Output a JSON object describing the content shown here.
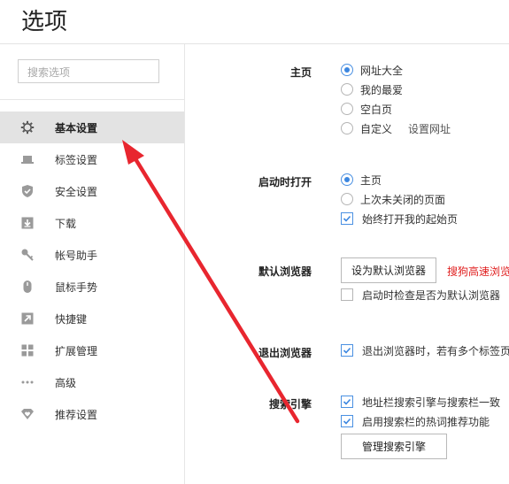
{
  "window": {
    "title": "选项"
  },
  "search": {
    "placeholder": "搜索选项"
  },
  "sidebar": {
    "items": [
      {
        "label": "基本设置",
        "icon": "gear-icon",
        "active": true
      },
      {
        "label": "标签设置",
        "icon": "tab-icon"
      },
      {
        "label": "安全设置",
        "icon": "shield-check-icon"
      },
      {
        "label": "下载",
        "icon": "download-icon"
      },
      {
        "label": "帐号助手",
        "icon": "key-icon"
      },
      {
        "label": "鼠标手势",
        "icon": "mouse-icon"
      },
      {
        "label": "快捷键",
        "icon": "shortcut-arrow-icon"
      },
      {
        "label": "扩展管理",
        "icon": "extensions-grid-icon"
      },
      {
        "label": "高级",
        "icon": "more-dots-icon"
      },
      {
        "label": "推荐设置",
        "icon": "heart-badge-icon"
      }
    ]
  },
  "homepage": {
    "label": "主页",
    "options": [
      "网址大全",
      "我的最爱",
      "空白页",
      "自定义"
    ],
    "selected": "网址大全",
    "set_url_link": "设置网址"
  },
  "startup": {
    "label": "启动时打开",
    "options": [
      "主页",
      "上次未关闭的页面"
    ],
    "selected": "主页",
    "always_open_start": {
      "label": "始终打开我的起始页",
      "checked": true
    }
  },
  "default_browser": {
    "label": "默认浏览器",
    "button": "设为默认浏览器",
    "notice": "搜狗高速浏览",
    "check_on_start": {
      "label": "启动时检查是否为默认浏览器",
      "checked": false
    }
  },
  "exit_browser": {
    "label": "退出浏览器",
    "option": {
      "label": "退出浏览器时，若有多个标签页",
      "checked": true
    }
  },
  "search_engine": {
    "label": "搜索引擎",
    "sync": {
      "label": "地址栏搜索引擎与搜索栏一致",
      "checked": true
    },
    "hot_words": {
      "label": "启用搜索栏的热词推荐功能",
      "checked": true
    },
    "manage_button": "管理搜索引擎"
  },
  "colors": {
    "accent": "#3b86e0",
    "annotation_arrow": "#e8262f",
    "notice_red": "#e02020"
  }
}
